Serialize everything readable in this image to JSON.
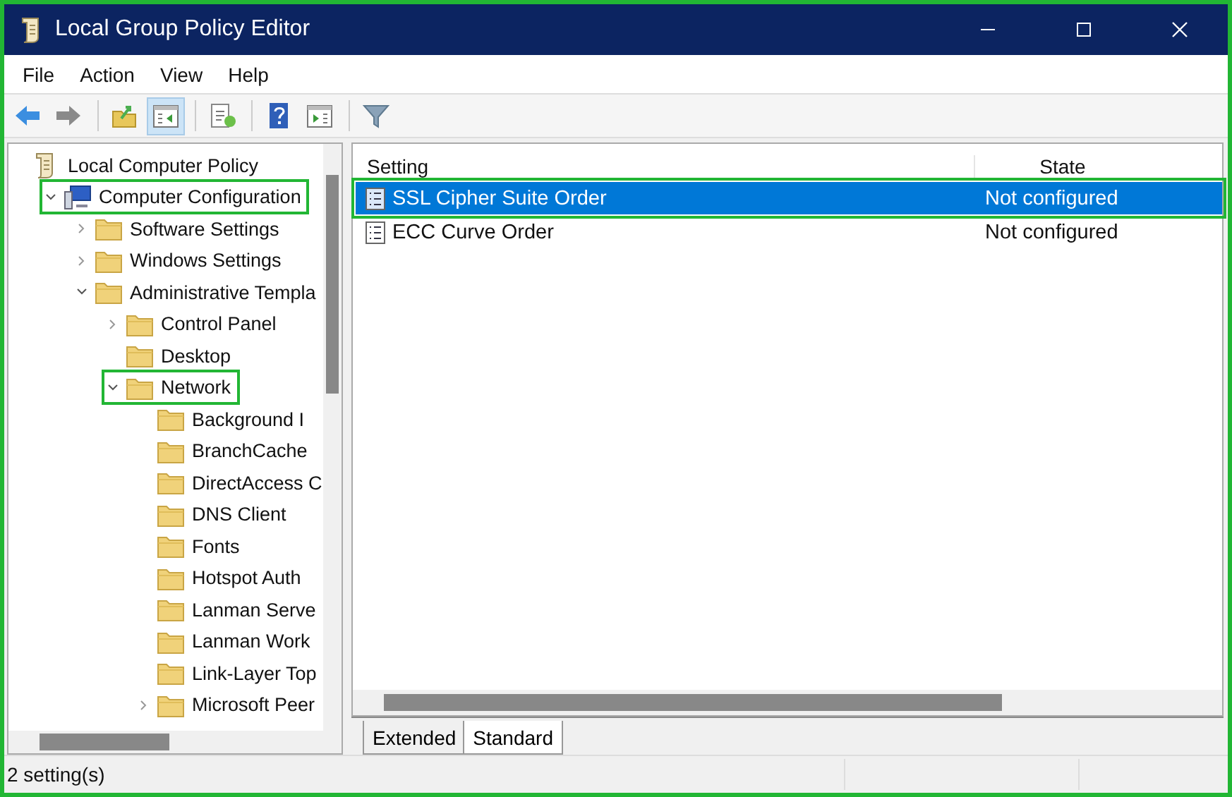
{
  "window": {
    "title": "Local Group Policy Editor"
  },
  "menu": [
    "File",
    "Action",
    "View",
    "Help"
  ],
  "toolbar": [
    {
      "pressed": false
    },
    {
      "pressed": false
    },
    {
      "pressed": false
    },
    {
      "pressed": true
    },
    {
      "pressed": false
    },
    {
      "pressed": false
    },
    {
      "pressed": false
    },
    {
      "pressed": false
    }
  ],
  "tree": [
    {
      "label": "Local Computer Policy",
      "kind": "policy",
      "expandable": false,
      "highlighted": false,
      "children": [
        {
          "label": "Computer Configuration",
          "kind": "computer",
          "expandable": true,
          "expanded": true,
          "highlighted": true,
          "children": [
            {
              "label": "Software Settings",
              "kind": "folder",
              "expandable": true,
              "expanded": false,
              "highlighted": false
            },
            {
              "label": "Windows Settings",
              "kind": "folder",
              "expandable": true,
              "expanded": false,
              "highlighted": false
            },
            {
              "label": "Administrative Templa",
              "kind": "folder",
              "expandable": true,
              "expanded": true,
              "highlighted": false,
              "children": [
                {
                  "label": "Control Panel",
                  "kind": "folder",
                  "expandable": true,
                  "expanded": false,
                  "highlighted": false
                },
                {
                  "label": "Desktop",
                  "kind": "folder",
                  "expandable": false,
                  "highlighted": false
                },
                {
                  "label": "Network",
                  "kind": "folder",
                  "expandable": true,
                  "expanded": true,
                  "highlighted": true,
                  "children": [
                    {
                      "label": "Background I",
                      "kind": "folder",
                      "expandable": false,
                      "highlighted": false
                    },
                    {
                      "label": "BranchCache",
                      "kind": "folder",
                      "expandable": false,
                      "highlighted": false
                    },
                    {
                      "label": "DirectAccess C",
                      "kind": "folder",
                      "expandable": false,
                      "highlighted": false
                    },
                    {
                      "label": "DNS Client",
                      "kind": "folder",
                      "expandable": false,
                      "highlighted": false
                    },
                    {
                      "label": "Fonts",
                      "kind": "folder",
                      "expandable": false,
                      "highlighted": false
                    },
                    {
                      "label": "Hotspot Auth",
                      "kind": "folder",
                      "expandable": false,
                      "highlighted": false
                    },
                    {
                      "label": "Lanman Serve",
                      "kind": "folder",
                      "expandable": false,
                      "highlighted": false
                    },
                    {
                      "label": "Lanman Work",
                      "kind": "folder",
                      "expandable": false,
                      "highlighted": false
                    },
                    {
                      "label": "Link-Layer Top",
                      "kind": "folder",
                      "expandable": false,
                      "highlighted": false
                    },
                    {
                      "label": "Microsoft Peer",
                      "kind": "folder",
                      "expandable": true,
                      "expanded": false,
                      "highlighted": false
                    }
                  ]
                }
              ]
            }
          ]
        }
      ]
    }
  ],
  "table": {
    "columns": [
      "Setting",
      "State"
    ],
    "rows": [
      {
        "setting": "SSL Cipher Suite Order",
        "state": "Not configured",
        "selected": true,
        "highlighted": true
      },
      {
        "setting": "ECC Curve Order",
        "state": "Not configured",
        "selected": false,
        "highlighted": false
      }
    ]
  },
  "tabs": [
    {
      "label": "Extended",
      "selected": false
    },
    {
      "label": "Standard",
      "selected": true
    }
  ],
  "status_bar": "2 setting(s)"
}
